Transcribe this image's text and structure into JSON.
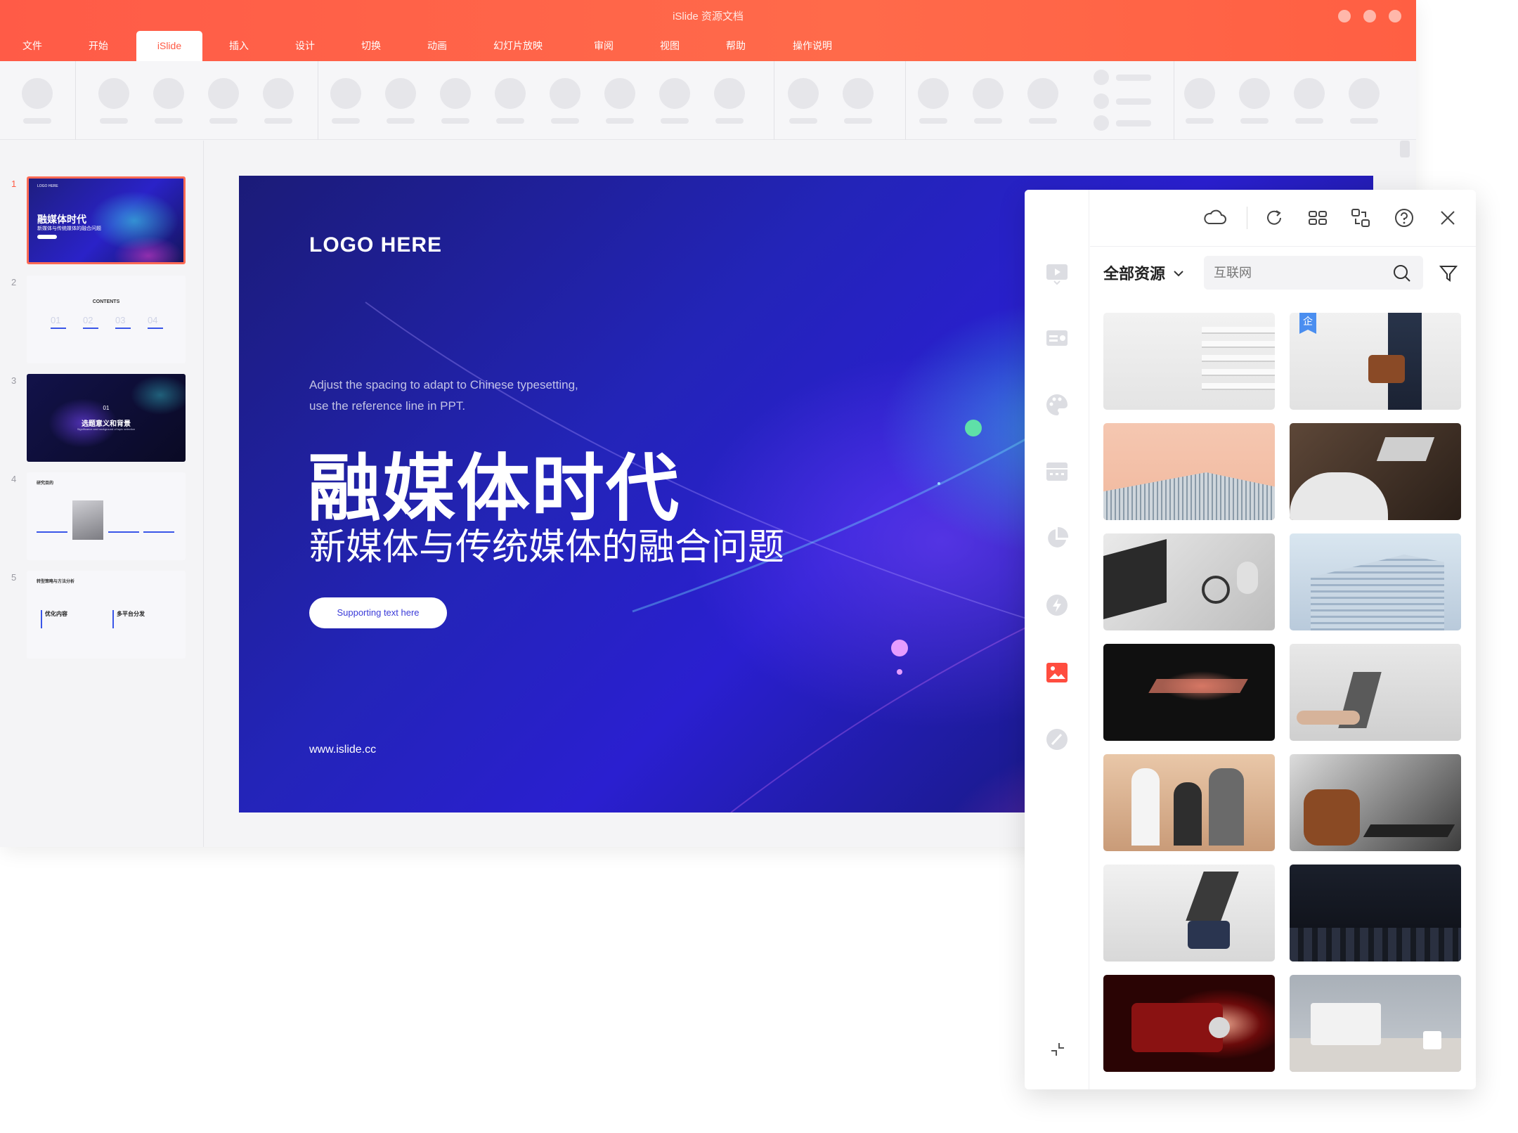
{
  "window": {
    "title": "iSlide 资源文档"
  },
  "menu": {
    "items": [
      "文件",
      "开始",
      "iSlide",
      "插入",
      "设计",
      "切换",
      "动画",
      "幻灯片放映",
      "审阅",
      "视图",
      "帮助",
      "操作说明"
    ],
    "active": "iSlide"
  },
  "slides": {
    "numbers": [
      "1",
      "2",
      "3",
      "4",
      "5"
    ],
    "thumb1": {
      "logo": "LOGO HERE",
      "title": "融媒体时代",
      "subtitle": "新媒体与传统媒体的融合问题"
    },
    "thumb2": {
      "title": "CONTENTS",
      "nums": [
        "01",
        "02",
        "03",
        "04"
      ]
    },
    "thumb3": {
      "num": "01",
      "title": "选题意义和背景",
      "sub": "Significance and background of topic selection"
    },
    "thumb4": {
      "title": "研究目的"
    },
    "thumb5": {
      "title": "转型策略与方法分析",
      "a": "优化内容",
      "b": "多平台分发"
    }
  },
  "slide": {
    "logo": "LOGO HERE",
    "tip_line1": "Adjust the spacing to adapt to Chinese typesetting,",
    "tip_line2": "use the reference line in PPT.",
    "title": "融媒体时代",
    "subtitle": "新媒体与传统媒体的融合问题",
    "button": "Supporting text here",
    "url": "www.islide.cc"
  },
  "panel": {
    "filter_label": "全部资源",
    "search_placeholder": "互联网",
    "badge": "企",
    "photos": [
      "stacked-papers",
      "businessman-briefcase",
      "glass-building",
      "laptop-desk-dark",
      "laptop-watch-mouse",
      "office-tower",
      "laptop-glow-dark",
      "hands-laptop",
      "team-meeting",
      "leather-chair-keyboard",
      "office-laptop-desk",
      "dark-auditorium",
      "red-projector",
      "macbook-grey"
    ]
  }
}
